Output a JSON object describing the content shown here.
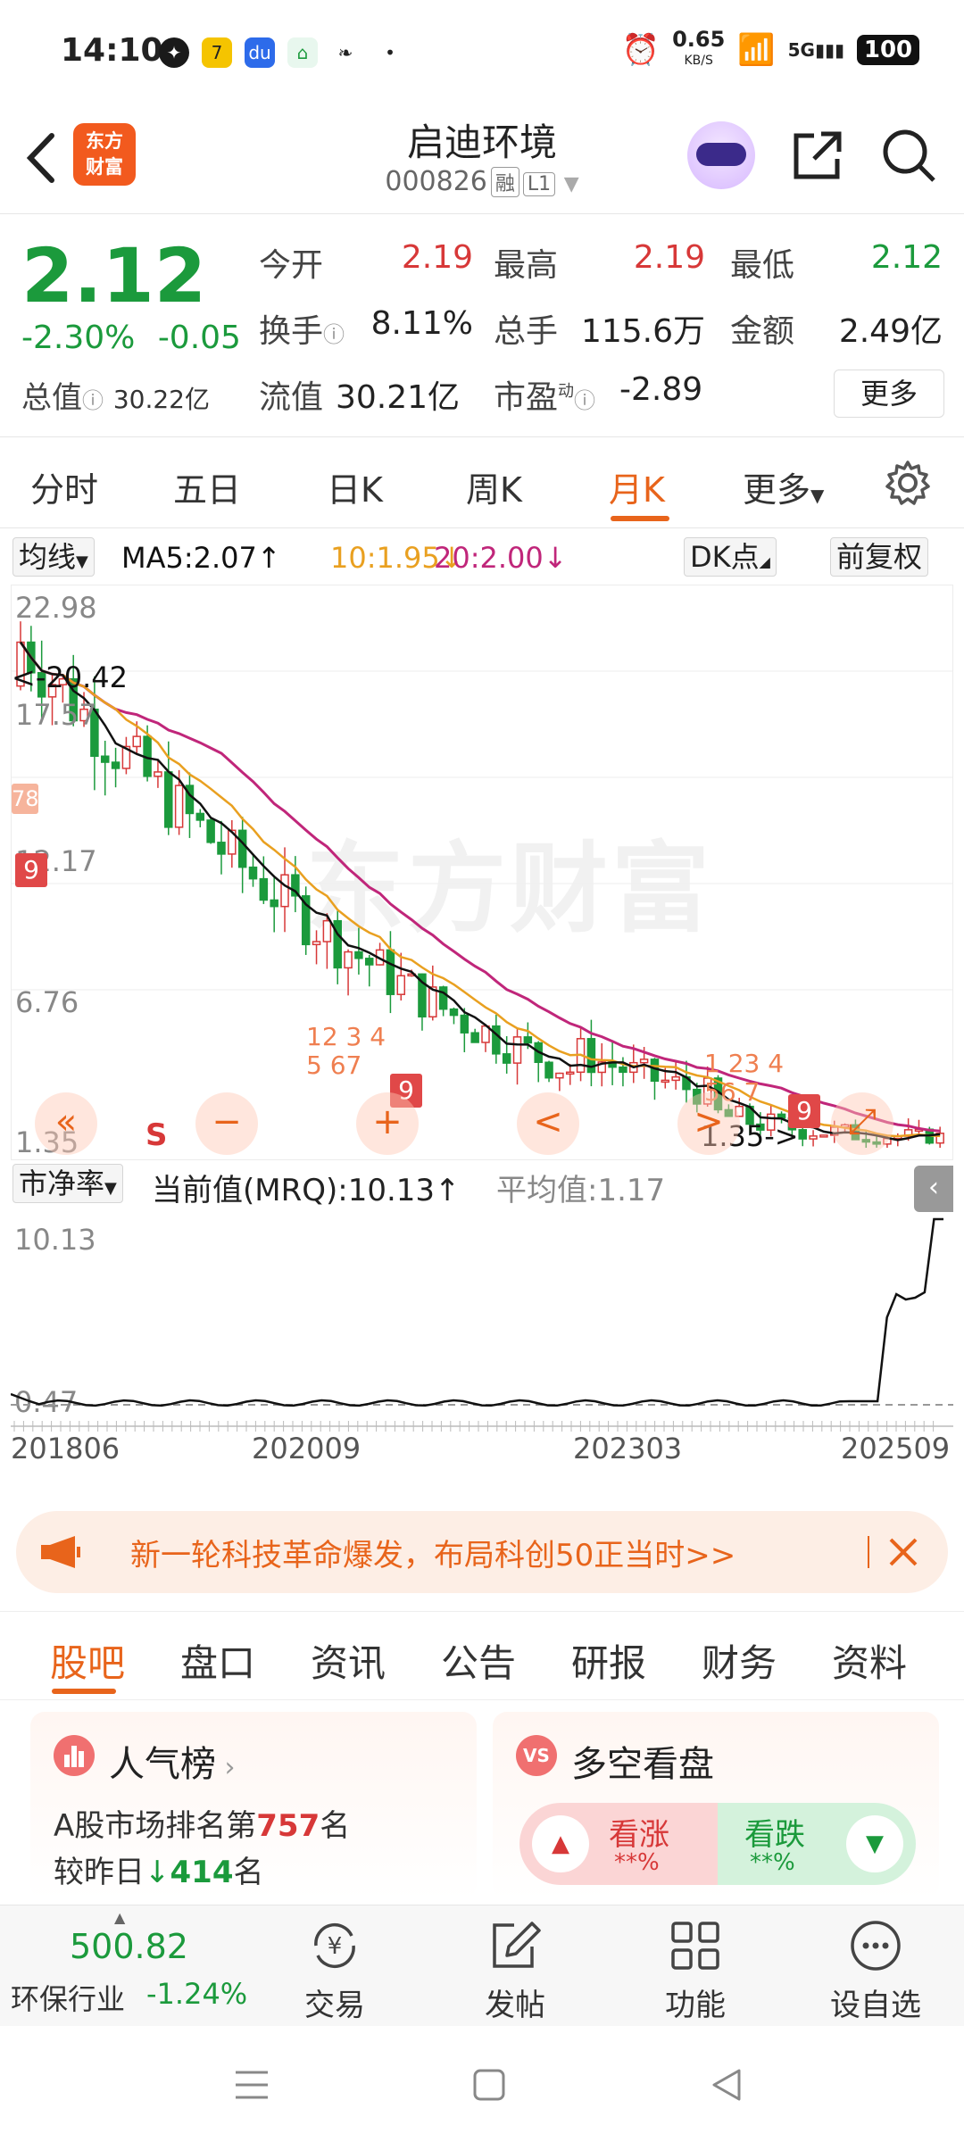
{
  "status_bar": {
    "time": "14:10",
    "net_speed": "0.65",
    "net_unit": "KB/S",
    "signal": "5G",
    "battery": "100"
  },
  "header": {
    "logo_line1": "东方",
    "logo_line2": "财富",
    "stock_name": "启迪环境",
    "stock_code": "000826",
    "tag_margin": "融",
    "tag_level": "L1"
  },
  "quote": {
    "price": "2.12",
    "change_pct": "-2.30%",
    "change_amt": "-0.05",
    "total_value_label": "总值",
    "total_value": "30.22亿",
    "open_label": "今开",
    "open": "2.19",
    "high_label": "最高",
    "high": "2.19",
    "low_label": "最低",
    "low": "2.12",
    "turnover_label": "换手",
    "turnover": "8.11%",
    "volume_label": "总手",
    "volume": "115.6万",
    "amount_label": "金额",
    "amount": "2.49亿",
    "float_label": "流值",
    "float_value": "30.21亿",
    "pe_label": "市盈",
    "pe_sup": "动",
    "pe": "-2.89",
    "more_label": "更多"
  },
  "period_tabs": [
    "分时",
    "五日",
    "日K",
    "周K",
    "月K",
    "更多"
  ],
  "active_period": "月K",
  "ma": {
    "selector": "均线",
    "ma5": "MA5:2.07↑",
    "ma10": "10:1.95↓",
    "ma20": "20:2.00↓",
    "dk_label": "DK点",
    "adjust_label": "前复权",
    "color_ma5": "#111111",
    "color_ma10": "#e9a020",
    "color_ma20": "#c0267a"
  },
  "kchart": {
    "watermark": "东方财富",
    "y_labels": [
      "22.98",
      "17.57",
      "12.17",
      "6.76",
      "1.35"
    ],
    "max_marker": "<-20.42",
    "min_marker": "1.35->",
    "s_marker": "S",
    "btn_prev": "«",
    "btn_minus": "−",
    "btn_plus": "+",
    "btn_left": "<",
    "btn_right": ">",
    "btn_expand": "⤢",
    "sig_9a": "9",
    "sig_78": "78",
    "sig_9b": "9",
    "sig_9c": "9",
    "sig_pale_a": "12 3 4 5 67",
    "sig_pale_b": "1 23 4 56 7"
  },
  "chart_data": {
    "type": "candlestick",
    "title": "",
    "ylim": [
      1.35,
      22.98
    ],
    "ma_lines": [
      "MA5",
      "MA10",
      "MA20"
    ]
  },
  "pb": {
    "selector": "市净率",
    "current": "当前值(MRQ):10.13↑",
    "average": "平均值:1.17",
    "y_top": "10.13",
    "y_bottom": "0.47",
    "x_labels": [
      "201806",
      "202009",
      "202303",
      "202509"
    ]
  },
  "banner": {
    "text": "新一轮科技革命爆发，布局科创50正当时>>"
  },
  "bottom_tabs": [
    "股吧",
    "盘口",
    "资讯",
    "公告",
    "研报",
    "财务",
    "资料"
  ],
  "cards": {
    "pop_title": "人气榜",
    "pop_rank_prefix": "A股市场排名第",
    "pop_rank": "757",
    "pop_rank_suffix": "名",
    "pop_change_prefix": "较昨日",
    "pop_change": "414",
    "pop_change_suffix": "名",
    "vs_badge": "VS",
    "vs_title": "多空看盘",
    "bull_label": "看涨",
    "bull_value": "**%",
    "bear_label": "看跌",
    "bear_value": "**%"
  },
  "bottom_nav": {
    "index_value": "500.82",
    "industry": "环保行业",
    "industry_chg": "-1.24%",
    "trade": "交易",
    "post": "发帖",
    "function": "功能",
    "watchlist": "设自选"
  }
}
